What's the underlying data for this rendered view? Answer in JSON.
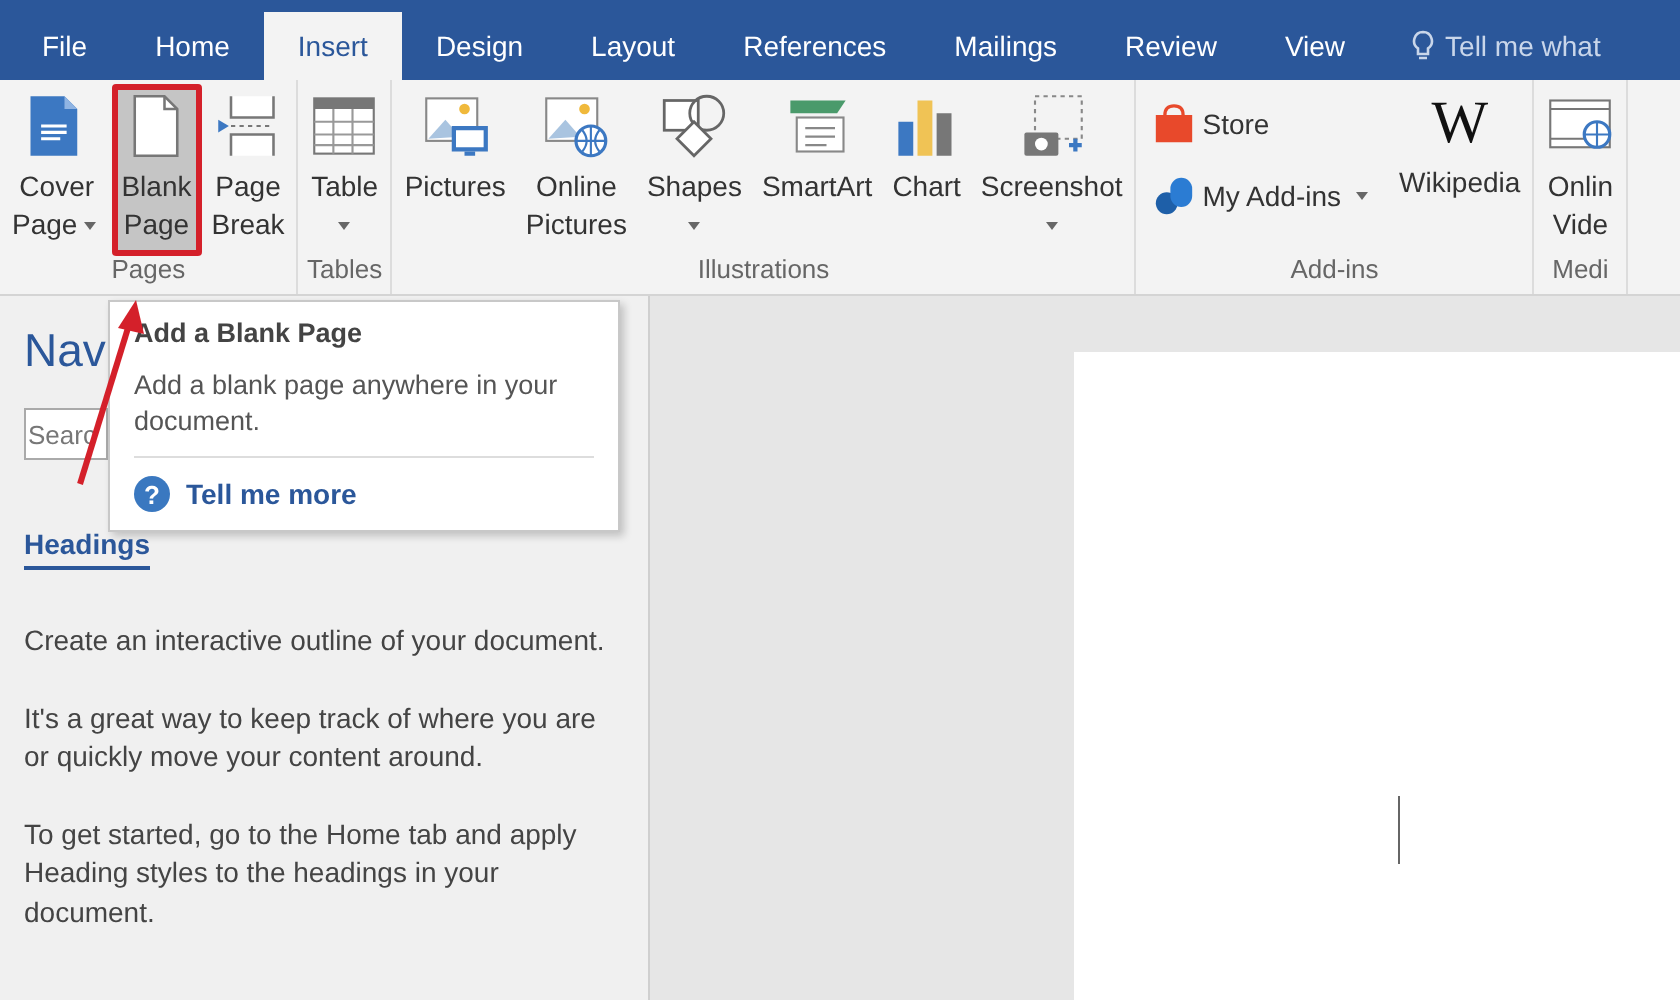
{
  "ribbon_tabs": [
    {
      "label": "File",
      "selected": false
    },
    {
      "label": "Home",
      "selected": false
    },
    {
      "label": "Insert",
      "selected": true
    },
    {
      "label": "Design",
      "selected": false
    },
    {
      "label": "Layout",
      "selected": false
    },
    {
      "label": "References",
      "selected": false
    },
    {
      "label": "Mailings",
      "selected": false
    },
    {
      "label": "Review",
      "selected": false
    },
    {
      "label": "View",
      "selected": false
    }
  ],
  "tell_me": "Tell me what",
  "groups": [
    {
      "label": "Pages",
      "commands": [
        {
          "kind": "large",
          "lines": [
            "Cover",
            "Page"
          ],
          "dropdown": true,
          "selected": false
        },
        {
          "kind": "large",
          "lines": [
            "Blank",
            "Page"
          ],
          "dropdown": false,
          "selected": true
        },
        {
          "kind": "large",
          "lines": [
            "Page",
            "Break"
          ],
          "dropdown": false,
          "selected": false
        }
      ]
    },
    {
      "label": "Tables",
      "commands": [
        {
          "kind": "large",
          "lines": [
            "Table"
          ],
          "dropdown": true,
          "selected": false
        }
      ]
    },
    {
      "label": "Illustrations",
      "commands": [
        {
          "kind": "large",
          "lines": [
            "Pictures"
          ],
          "dropdown": false,
          "selected": false
        },
        {
          "kind": "large",
          "lines": [
            "Online",
            "Pictures"
          ],
          "dropdown": false,
          "selected": false
        },
        {
          "kind": "large",
          "lines": [
            "Shapes"
          ],
          "dropdown": true,
          "selected": false
        },
        {
          "kind": "large",
          "lines": [
            "SmartArt"
          ],
          "dropdown": false,
          "selected": false
        },
        {
          "kind": "large",
          "lines": [
            "Chart"
          ],
          "dropdown": false,
          "selected": false
        },
        {
          "kind": "large",
          "lines": [
            "Screenshot"
          ],
          "dropdown": true,
          "selected": false
        }
      ]
    },
    {
      "label": "Add-ins",
      "commands": [
        {
          "kind": "small",
          "lines": [
            "Store"
          ],
          "dropdown": false,
          "selected": false
        },
        {
          "kind": "small",
          "lines": [
            "My Add-ins"
          ],
          "dropdown": true,
          "selected": false
        },
        {
          "kind": "large",
          "glyph": "W",
          "lines": [
            "Wikipedia"
          ],
          "dropdown": false,
          "selected": false
        }
      ]
    },
    {
      "label": "Medi",
      "commands": [
        {
          "kind": "large",
          "lines": [
            "Onlin",
            "Vide"
          ],
          "dropdown": false,
          "selected": false
        }
      ]
    }
  ],
  "navigation": {
    "title": "Nav",
    "search": {
      "placeholder": "Searc"
    },
    "tabs": [
      {
        "label": "Headings",
        "selected": true
      }
    ],
    "paragraphs": [
      "Create an interactive outline of your document.",
      "It's a great way to keep track of where you are or quickly move your content around.",
      "To get started, go to the Home tab and apply Heading styles to the headings in your document."
    ]
  },
  "tooltip": {
    "title": "Add a Blank Page",
    "body": "Add a blank page anywhere in your document.",
    "help_glyph": "?",
    "link": "Tell me more"
  }
}
